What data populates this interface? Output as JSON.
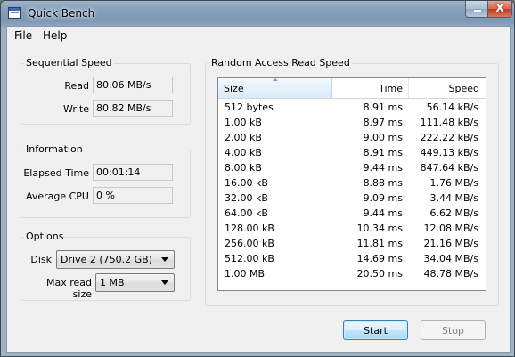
{
  "window": {
    "title": "Quick Bench",
    "minimize_glyph": "",
    "close_glyph": "X"
  },
  "menu": {
    "items": [
      "File",
      "Help"
    ]
  },
  "sequential": {
    "title": "Sequential Speed",
    "read_label": "Read",
    "read_value": "80.06 MB/s",
    "write_label": "Write",
    "write_value": "80.82 MB/s"
  },
  "information": {
    "title": "Information",
    "elapsed_label": "Elapsed Time",
    "elapsed_value": "00:01:14",
    "cpu_label": "Average CPU",
    "cpu_value": "0 %"
  },
  "options": {
    "title": "Options",
    "disk_label": "Disk",
    "disk_value": "Drive 2 (750.2 GB)",
    "maxread_label": "Max read size",
    "maxread_value": "1 MB"
  },
  "random": {
    "title": "Random Access Read Speed",
    "columns": {
      "size": "Size",
      "time": "Time",
      "speed": "Speed"
    },
    "rows": [
      {
        "size": "512 bytes",
        "time": "8.91 ms",
        "speed": "56.14 kB/s"
      },
      {
        "size": "1.00 kB",
        "time": "8.97 ms",
        "speed": "111.48 kB/s"
      },
      {
        "size": "2.00 kB",
        "time": "9.00 ms",
        "speed": "222.22 kB/s"
      },
      {
        "size": "4.00 kB",
        "time": "8.91 ms",
        "speed": "449.13 kB/s"
      },
      {
        "size": "8.00 kB",
        "time": "9.44 ms",
        "speed": "847.64 kB/s"
      },
      {
        "size": "16.00 kB",
        "time": "8.88 ms",
        "speed": "1.76 MB/s"
      },
      {
        "size": "32.00 kB",
        "time": "9.09 ms",
        "speed": "3.44 MB/s"
      },
      {
        "size": "64.00 kB",
        "time": "9.44 ms",
        "speed": "6.62 MB/s"
      },
      {
        "size": "128.00 kB",
        "time": "10.34 ms",
        "speed": "12.08 MB/s"
      },
      {
        "size": "256.00 kB",
        "time": "11.81 ms",
        "speed": "21.16 MB/s"
      },
      {
        "size": "512.00 kB",
        "time": "14.69 ms",
        "speed": "34.04 MB/s"
      },
      {
        "size": "1.00 MB",
        "time": "20.50 ms",
        "speed": "48.78 MB/s"
      }
    ]
  },
  "buttons": {
    "start": "Start",
    "stop": "Stop"
  },
  "icons": {
    "app": "app-window-icon",
    "sort": "sort-ascending-icon",
    "dropdown": "chevron-down-icon"
  },
  "colors": {
    "titlebar": "#8aa2bb",
    "close": "#c2391c",
    "accent": "#3c7fb1"
  }
}
